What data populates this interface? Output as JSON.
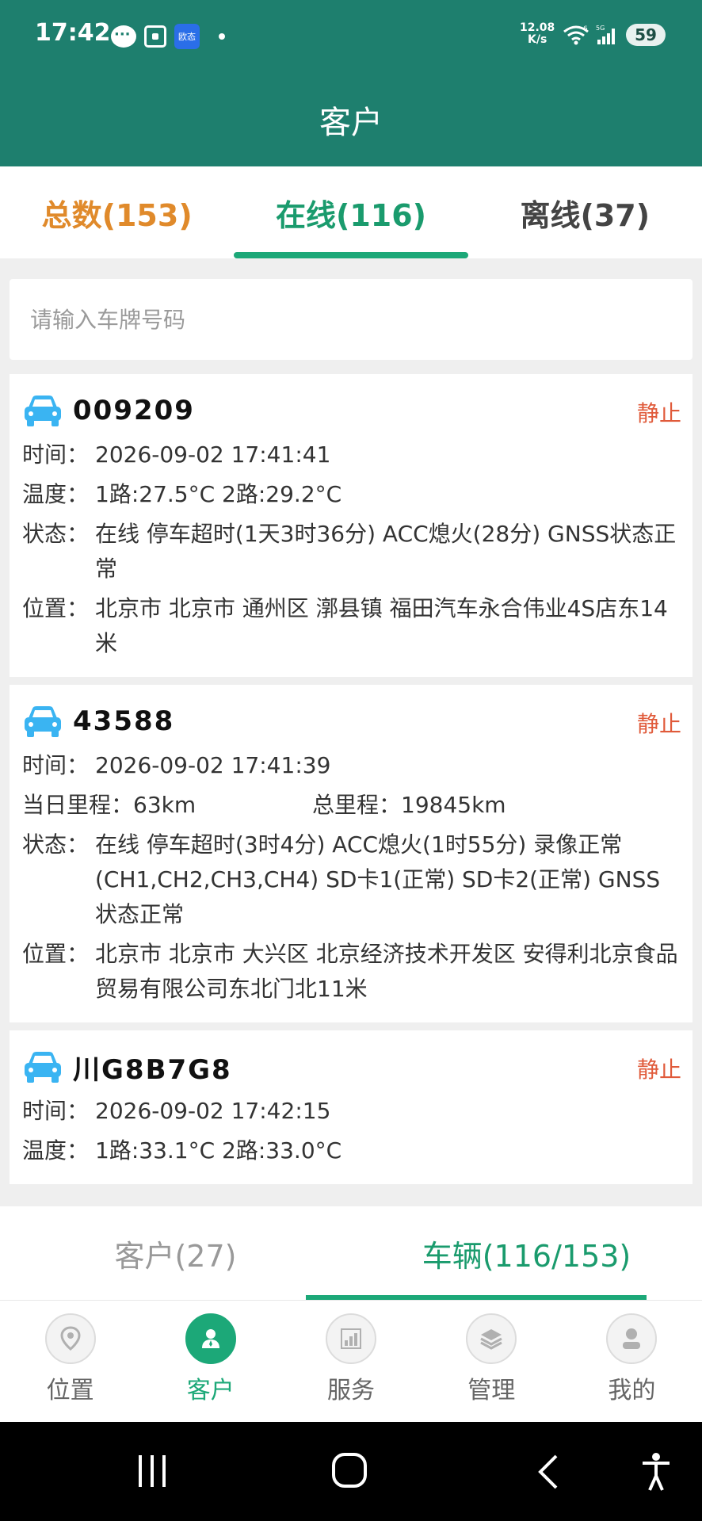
{
  "status_bar": {
    "time": "17:42",
    "app_badge": "欧态",
    "net_speed_value": "12.08",
    "net_speed_unit": "K/s",
    "wifi_small": "6",
    "signal_small": "5G",
    "battery": "59"
  },
  "header": {
    "title": "客户"
  },
  "filter_tabs": [
    {
      "label": "总数(153)"
    },
    {
      "label": "在线(116)"
    },
    {
      "label": "离线(37)"
    }
  ],
  "search": {
    "placeholder": "请输入车牌号码"
  },
  "labels": {
    "time": "时间：",
    "temp": "温度：",
    "state": "状态：",
    "location": "位置："
  },
  "vehicles": [
    {
      "plate": "009209",
      "status": "静止",
      "time": "2026-09-02 17:41:41",
      "temperature": "1路:27.5°C   2路:29.2°C",
      "state": "在线 停车超时(1天3时36分) ACC熄火(28分) GNSS状态正常",
      "location": "北京市 北京市 通州区 漷县镇 福田汽车永合伟业4S店东14米"
    },
    {
      "plate": "43588",
      "status": "静止",
      "time": "2026-09-02 17:41:39",
      "daily_mileage": "当日里程：63km",
      "total_mileage": "总里程：19845km",
      "state": "在线 停车超时(3时4分) ACC熄火(1时55分) 录像正常(CH1,CH2,CH3,CH4) SD卡1(正常) SD卡2(正常) GNSS状态正常",
      "location": "北京市 北京市 大兴区 北京经济技术开发区 安得利北京食品贸易有限公司东北门北11米"
    },
    {
      "plate": "川G8B7G8",
      "status": "静止",
      "time": "2026-09-02 17:42:15",
      "temperature": "1路:33.1°C   2路:33.0°C"
    }
  ],
  "sub_tabs": [
    {
      "label": "客户(27)"
    },
    {
      "label": "车辆(116/153)"
    }
  ],
  "bottom_nav": [
    {
      "label": "位置",
      "icon": "location-pin-icon"
    },
    {
      "label": "客户",
      "icon": "user-icon"
    },
    {
      "label": "服务",
      "icon": "bar-chart-icon"
    },
    {
      "label": "管理",
      "icon": "layers-icon"
    },
    {
      "label": "我的",
      "icon": "profile-icon"
    }
  ],
  "colors": {
    "brand": "#1e7f6e",
    "accent": "#1ca878",
    "total": "#e08a2b",
    "stopped": "#e05a3a",
    "car": "#3ab4f2"
  }
}
